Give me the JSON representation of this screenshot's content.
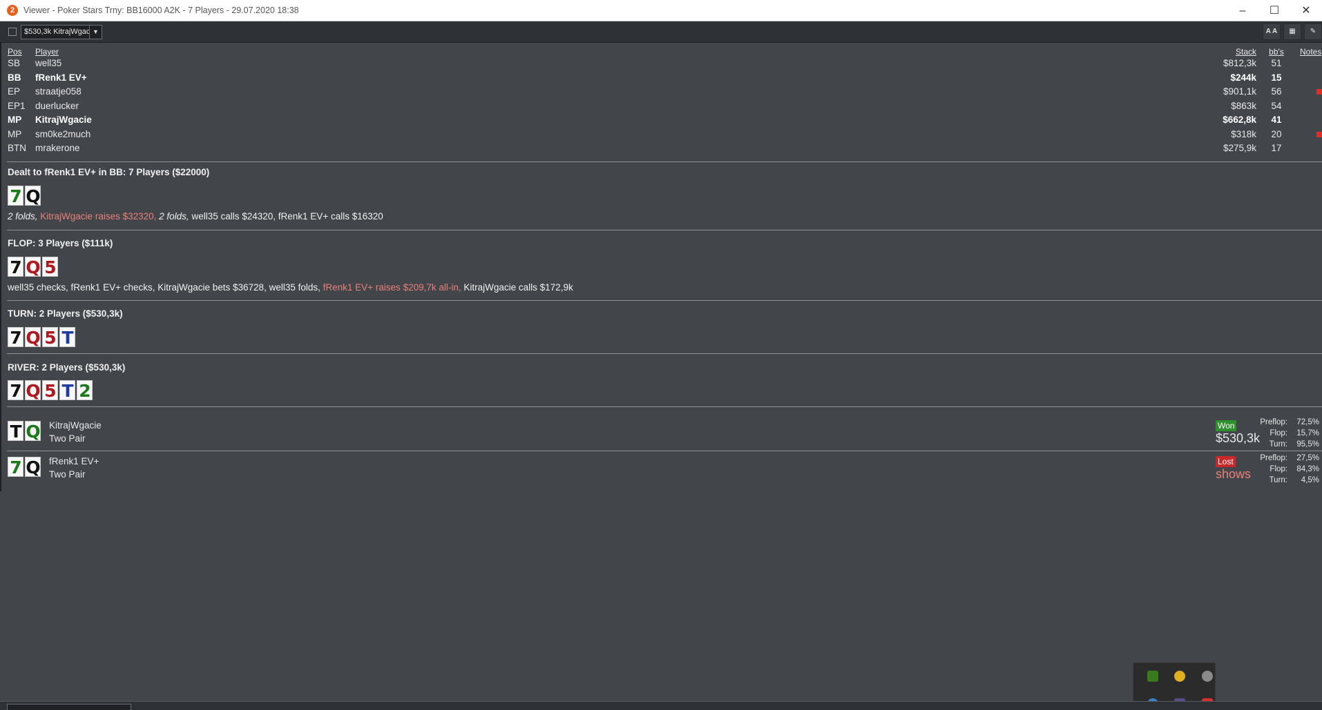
{
  "window": {
    "app_icon": "2",
    "title": "Viewer - Poker Stars Trny: BB16000 A2K - 7 Players - 29.07.2020 18:38"
  },
  "toolbar": {
    "selected_hand": "$530,3k KitrajWgac",
    "font_button": "A A"
  },
  "players_table": {
    "headers": {
      "pos": "Pos",
      "player": "Player",
      "stack": "Stack",
      "bbs": "bb's",
      "notes": "Notes"
    },
    "rows": [
      {
        "pos": "SB",
        "player": "well35",
        "stack": "$812,3k",
        "bbs": "51",
        "bold": false,
        "flag": false
      },
      {
        "pos": "BB",
        "player": "fRenk1 EV+",
        "stack": "$244k",
        "bbs": "15",
        "bold": true,
        "flag": false
      },
      {
        "pos": "EP",
        "player": "straatje058",
        "stack": "$901,1k",
        "bbs": "56",
        "bold": false,
        "flag": true
      },
      {
        "pos": "EP1",
        "player": "duerlucker",
        "stack": "$863k",
        "bbs": "54",
        "bold": false,
        "flag": false
      },
      {
        "pos": "MP",
        "player": "KitrajWgacie",
        "stack": "$662,8k",
        "bbs": "41",
        "bold": true,
        "flag": false
      },
      {
        "pos": "MP",
        "player": "sm0ke2much",
        "stack": "$318k",
        "bbs": "20",
        "bold": false,
        "flag": true
      },
      {
        "pos": "BTN",
        "player": "mrakerone",
        "stack": "$275,9k",
        "bbs": "17",
        "bold": false,
        "flag": false
      }
    ]
  },
  "preflop": {
    "title": "Dealt to fRenk1 EV+ in BB: 7 Players ($22000)",
    "cards": [
      {
        "rank": "7",
        "suit": "c"
      },
      {
        "rank": "Q",
        "suit": "s"
      }
    ],
    "actions": {
      "a1": "2 folds,",
      "a2": "KitrajWgacie raises $32320,",
      "a3": "2 folds,",
      "a4": "well35 calls $24320, fRenk1 EV+ calls $16320"
    }
  },
  "flop": {
    "title": "FLOP: 3 Players ($111k)",
    "cards": [
      {
        "rank": "7",
        "suit": "s"
      },
      {
        "rank": "Q",
        "suit": "h"
      },
      {
        "rank": "5",
        "suit": "h"
      }
    ],
    "actions": {
      "a1": "well35 checks, fRenk1 EV+ checks, KitrajWgacie bets $36728, well35 folds,",
      "a2": "fRenk1 EV+ raises $209,7k all-in,",
      "a3": "KitrajWgacie calls $172,9k"
    }
  },
  "turn": {
    "title": "TURN: 2 Players ($530,3k)",
    "cards": [
      {
        "rank": "7",
        "suit": "s"
      },
      {
        "rank": "Q",
        "suit": "h"
      },
      {
        "rank": "5",
        "suit": "h"
      },
      {
        "rank": "T",
        "suit": "d"
      }
    ]
  },
  "river": {
    "title": "RIVER: 2 Players ($530,3k)",
    "cards": [
      {
        "rank": "7",
        "suit": "s"
      },
      {
        "rank": "Q",
        "suit": "h"
      },
      {
        "rank": "5",
        "suit": "h"
      },
      {
        "rank": "T",
        "suit": "d"
      },
      {
        "rank": "2",
        "suit": "c"
      }
    ]
  },
  "results": [
    {
      "cards": [
        {
          "rank": "T",
          "suit": "s"
        },
        {
          "rank": "Q",
          "suit": "c"
        }
      ],
      "name": "KitrajWgacie",
      "hand": "Two Pair",
      "badge": "Won",
      "amount": "$530,3k",
      "equity": [
        {
          "label": "Preflop:",
          "value": "72,5%"
        },
        {
          "label": "Flop:",
          "value": "15,7%"
        },
        {
          "label": "Turn:",
          "value": "95,5%"
        }
      ]
    },
    {
      "cards": [
        {
          "rank": "7",
          "suit": "c"
        },
        {
          "rank": "Q",
          "suit": "s"
        }
      ],
      "name": "fRenk1 EV+",
      "hand": "Two Pair",
      "badge": "Lost",
      "amount": "shows",
      "equity": [
        {
          "label": "Preflop:",
          "value": "27,5%"
        },
        {
          "label": "Flop:",
          "value": "84,3%"
        },
        {
          "label": "Turn:",
          "value": "4,5%"
        }
      ]
    }
  ],
  "colors": {
    "background": "#42464b",
    "highlight_action": "#e88079",
    "won": "#2e8f2e",
    "lost": "#c8282a"
  },
  "tray_icons": [
    "nvidia-icon",
    "yellow-circle-icon",
    "s-circle-icon",
    "globe-icon",
    "feather-icon",
    "red-app-icon"
  ]
}
